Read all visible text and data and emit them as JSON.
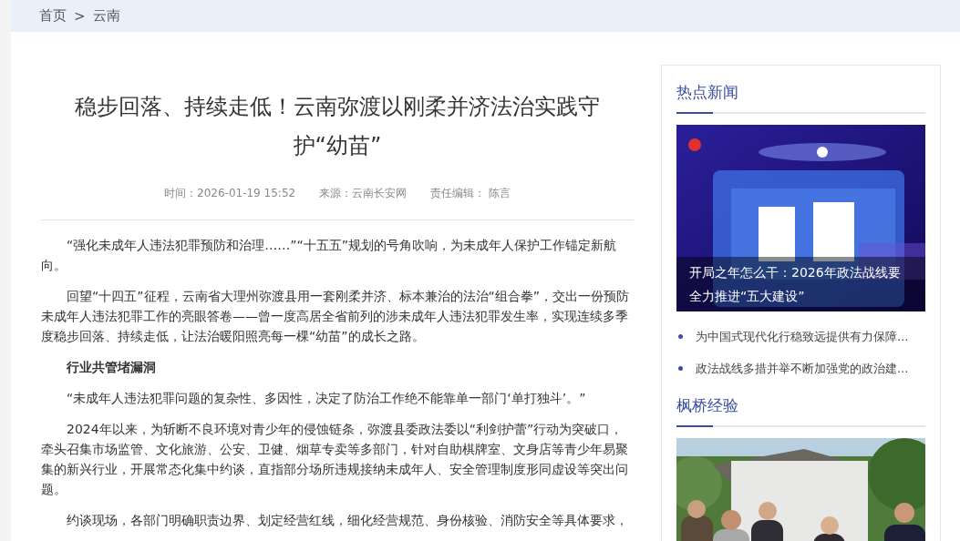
{
  "breadcrumb": {
    "items": [
      {
        "label": "首页"
      },
      {
        "label": "云南"
      }
    ],
    "separator": ">"
  },
  "article": {
    "title": "稳步回落、持续走低！云南弥渡以刚柔并济法治实践守护“幼苗”",
    "meta": [
      "时间：2026-01-19 15:52",
      "来源：云南长安网",
      "责任编辑： 陈言"
    ],
    "paragraphs": [
      {
        "kind": "text",
        "text": "“强化未成年人违法犯罪预防和治理……”“十五五”规划的号角吹响，为未成年人保护工作锚定新航向。"
      },
      {
        "kind": "text",
        "text": "回望“十四五”征程，云南省大理州弥渡县用一套刚柔并济、标本兼治的法治“组合拳”，交出一份预防未成年人违法犯罪工作的亮眼答卷——曾一度高居全省前列的涉未成年人违法犯罪发生率，实现连续多季度稳步回落、持续走低，让法治暖阳照亮每一棵“幼苗”的成长之路。"
      },
      {
        "kind": "heading",
        "text": "行业共管堵漏洞"
      },
      {
        "kind": "text",
        "text": "“未成年人违法犯罪问题的复杂性、多因性，决定了防治工作绝不能靠单一部门‘单打独斗’。”"
      },
      {
        "kind": "text",
        "text": "2024年以来，为斩断不良环境对青少年的侵蚀链条，弥渡县委政法委以“利剑护蕾”行动为突破口，牵头召集市场监管、文化旅游、公安、卫健、烟草专卖等多部门，针对自助棋牌室、文身店等青少年易聚集的新兴行业，开展常态化集中约谈，直指部分场所违规接纳未成年人、安全管理制度形同虚设等突出问题。"
      },
      {
        "kind": "text",
        "text": "约谈现场，各部门明确职责边界、划定经营红线，细化经营规范、身份核验、消防安全等具体要求，"
      }
    ]
  },
  "sidebar": {
    "sections": [
      {
        "title": "热点新闻",
        "feature": {
          "kind": "picture",
          "caption": "开局之年怎么干：2026年政法战线要全力推进“五大建设”"
        },
        "items": [
          "为中国式现代化行稳致远提供有力保障...",
          "政法战线多措并举不断加强党的政治建..."
        ]
      },
      {
        "title": "枫桥经验"
      }
    ]
  }
}
